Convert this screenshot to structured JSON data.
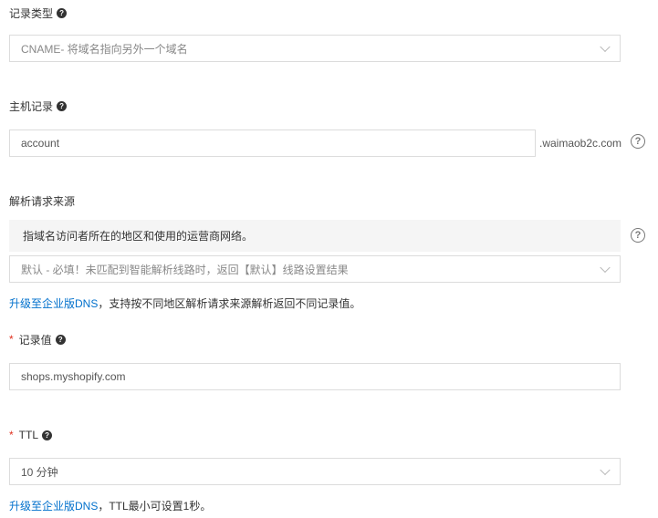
{
  "record_type": {
    "label": "记录类型",
    "value": "CNAME- 将域名指向另外一个域名"
  },
  "host_record": {
    "label": "主机记录",
    "value": "account",
    "suffix": ".waimaob2c.com"
  },
  "resolve_source": {
    "label": "解析请求来源",
    "info": "指域名访问者所在的地区和使用的运营商网络。",
    "select_value": "默认 - 必填！未匹配到智能解析线路时，返回【默认】线路设置结果",
    "upgrade_link": "升级至企业版DNS",
    "upgrade_text": "，支持按不同地区解析请求来源解析返回不同记录值。"
  },
  "record_value": {
    "required_mark": "*",
    "label": "记录值",
    "value": "shops.myshopify.com"
  },
  "ttl": {
    "required_mark": "*",
    "label": "TTL",
    "value": "10 分钟",
    "upgrade_link": "升级至企业版DNS",
    "upgrade_text": "，TTL最小可设置1秒。"
  },
  "icons": {
    "question_small": "?",
    "help_circle": "?"
  }
}
